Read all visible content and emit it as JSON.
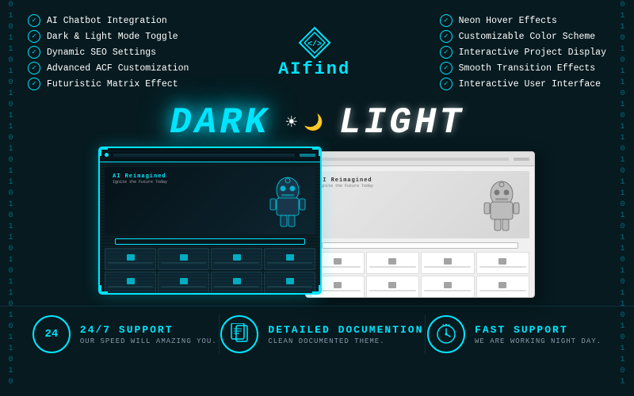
{
  "matrix": {
    "chars_left": "0\n1\n0\n1\n1\n0\n1\n0\n1\n0\n1\n1\n0\n1\n0\n1\n1\n0\n1\n0\n1\n1\n0\n1\n0\n1\n1\n0\n1\n0\n1\n1\n0\n1\n0",
    "chars_right": "0\n1\n1\n0\n1\n0\n1\n1\n0\n1\n0\n1\n1\n0\n1\n0\n1\n1\n0\n1\n0\n1\n1\n0\n1\n0\n1\n1\n0\n1\n0\n1\n1\n0\n1"
  },
  "features": {
    "left": [
      "AI Chatbot Integration",
      "Dark & Light Mode Toggle",
      "Dynamic SEO Settings",
      "Advanced ACF Customization",
      "Futuristic Matrix Effect"
    ],
    "right": [
      "Neon Hover Effects",
      "Customizable Color Scheme",
      "Interactive Project Display",
      "Smooth Transition Effects",
      "Interactive User Interface"
    ]
  },
  "logo": {
    "text_pre": "AI",
    "text_post": "find"
  },
  "mode": {
    "dark_label": "DARK",
    "light_label": "LIGHT"
  },
  "dark_preview": {
    "hero_title": "AI Reimagined",
    "hero_sub": "Ignite the Future Today"
  },
  "light_preview": {
    "hero_title": "AI Reimagined",
    "hero_sub": "Ignite the Future Today"
  },
  "bottom": {
    "support_title": "24/7 SUPPORT",
    "support_sub": "OUR SPEED WILL AMAZING YOU.",
    "docs_title": "DETAILED DOCUMENTION",
    "docs_sub": "CLEAN DOCUMENTED THEME.",
    "fast_title": "FAST SUPPORT",
    "fast_sub": "WE ARE WORKING NIGHT DAY."
  }
}
